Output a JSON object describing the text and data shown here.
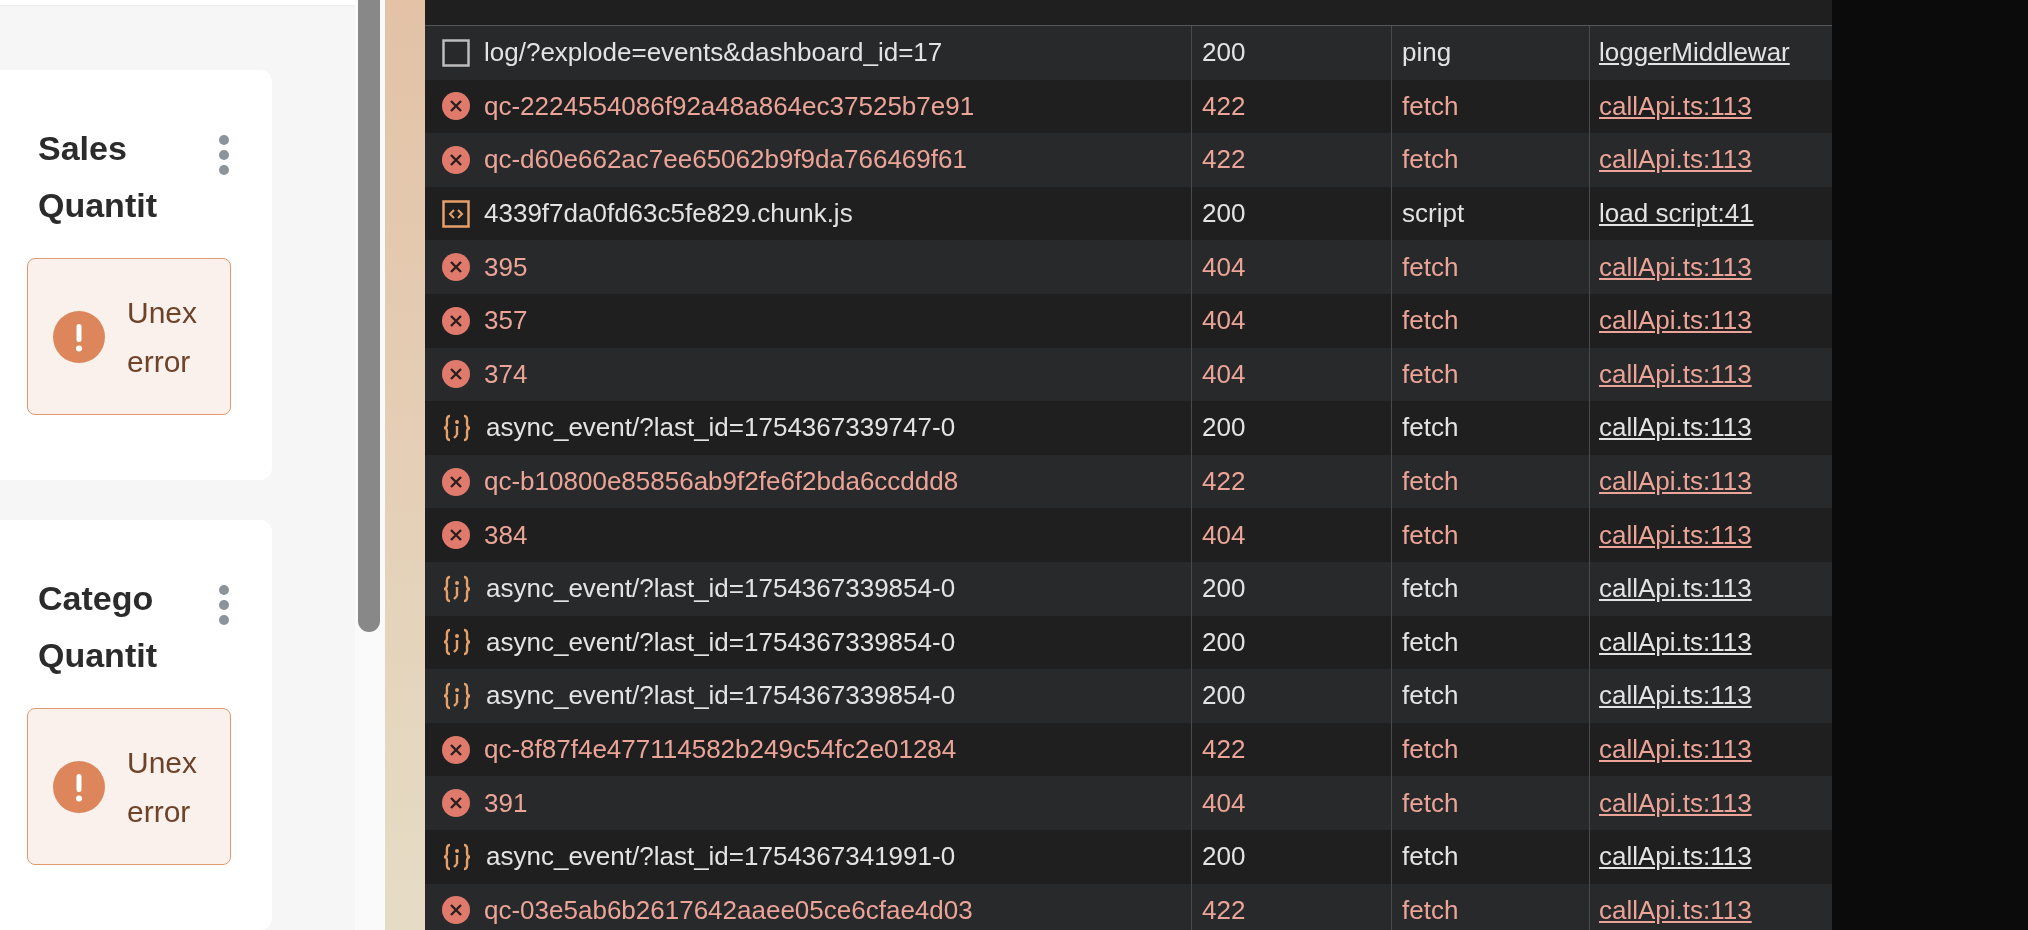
{
  "dashboard": {
    "cards": [
      {
        "title": "Sales Quantit",
        "error": "Unex error"
      },
      {
        "title": "Catego Quantit",
        "error": "Unex error"
      }
    ]
  },
  "network": {
    "rows": [
      {
        "kind": "ping",
        "name": "log/?explode=events&dashboard_id=17",
        "status": "200",
        "type": "ping",
        "initiator": "loggerMiddlewar"
      },
      {
        "kind": "error",
        "name": "qc-2224554086f92a48a864ec37525b7e91",
        "status": "422",
        "type": "fetch",
        "initiator": "callApi.ts:113"
      },
      {
        "kind": "error",
        "name": "qc-d60e662ac7ee65062b9f9da766469f61",
        "status": "422",
        "type": "fetch",
        "initiator": "callApi.ts:113"
      },
      {
        "kind": "script",
        "name": "4339f7da0fd63c5fe829.chunk.js",
        "status": "200",
        "type": "script",
        "initiator": "load script:41"
      },
      {
        "kind": "error",
        "name": "395",
        "status": "404",
        "type": "fetch",
        "initiator": "callApi.ts:113"
      },
      {
        "kind": "error",
        "name": "357",
        "status": "404",
        "type": "fetch",
        "initiator": "callApi.ts:113"
      },
      {
        "kind": "error",
        "name": "374",
        "status": "404",
        "type": "fetch",
        "initiator": "callApi.ts:113"
      },
      {
        "kind": "fetch",
        "name": "async_event/?last_id=1754367339747-0",
        "status": "200",
        "type": "fetch",
        "initiator": "callApi.ts:113"
      },
      {
        "kind": "error",
        "name": "qc-b10800e85856ab9f2fe6f2bda6ccddd8",
        "status": "422",
        "type": "fetch",
        "initiator": "callApi.ts:113"
      },
      {
        "kind": "error",
        "name": "384",
        "status": "404",
        "type": "fetch",
        "initiator": "callApi.ts:113"
      },
      {
        "kind": "fetch",
        "name": "async_event/?last_id=1754367339854-0",
        "status": "200",
        "type": "fetch",
        "initiator": "callApi.ts:113"
      },
      {
        "kind": "fetch",
        "name": "async_event/?last_id=1754367339854-0",
        "status": "200",
        "type": "fetch",
        "initiator": "callApi.ts:113"
      },
      {
        "kind": "fetch",
        "name": "async_event/?last_id=1754367339854-0",
        "status": "200",
        "type": "fetch",
        "initiator": "callApi.ts:113"
      },
      {
        "kind": "error",
        "name": "qc-8f87f4e477114582b249c54fc2e01284",
        "status": "422",
        "type": "fetch",
        "initiator": "callApi.ts:113"
      },
      {
        "kind": "error",
        "name": "391",
        "status": "404",
        "type": "fetch",
        "initiator": "callApi.ts:113"
      },
      {
        "kind": "fetch",
        "name": "async_event/?last_id=1754367341991-0",
        "status": "200",
        "type": "fetch",
        "initiator": "callApi.ts:113"
      },
      {
        "kind": "error",
        "name": "qc-03e5ab6b2617642aaee05ce6cfae4d03",
        "status": "422",
        "type": "fetch",
        "initiator": "callApi.ts:113"
      }
    ]
  }
}
